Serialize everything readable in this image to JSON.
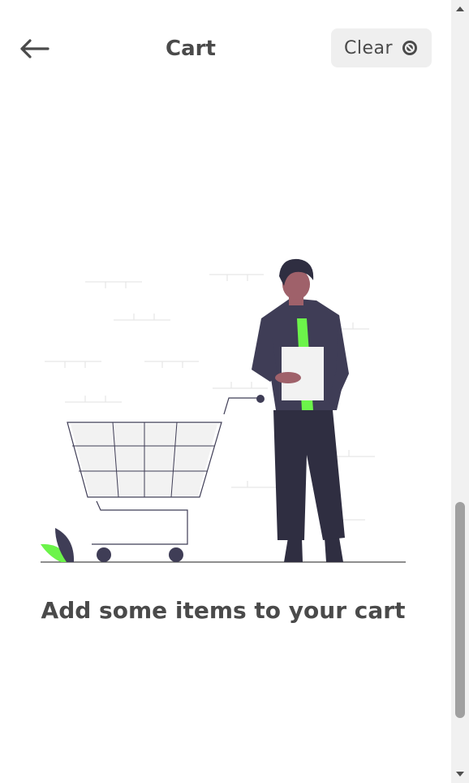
{
  "header": {
    "title": "Cart",
    "clear_label": "Clear",
    "back_icon": "arrow-left-icon",
    "clear_icon": "cancel-circle-icon"
  },
  "empty_state": {
    "message": "Add some items to your cart",
    "illustration": "person-with-shopping-cart"
  },
  "colors": {
    "accent": "#6cf44a",
    "dark": "#3f3d56",
    "skin": "#9f616a",
    "text": "#4a4a4a",
    "button_bg": "#efefef"
  }
}
